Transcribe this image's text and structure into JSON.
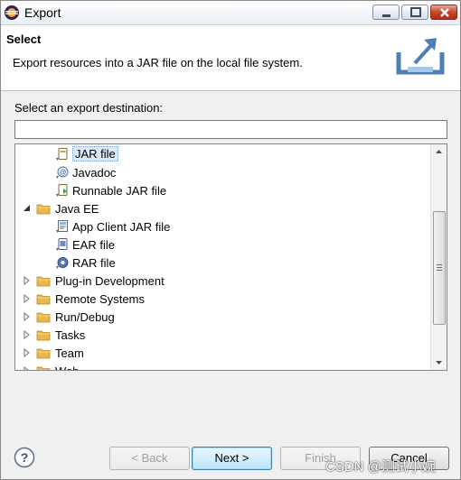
{
  "window": {
    "title": "Export",
    "controls": {
      "minimize": "minimize",
      "maximize": "maximize",
      "close": "close"
    }
  },
  "banner": {
    "title": "Select",
    "description": "Export resources into a JAR file on the local file system."
  },
  "destination": {
    "label": "Select an export destination:",
    "filter_value": "",
    "filter_placeholder": ""
  },
  "tree": {
    "items": [
      {
        "label": "JAR file",
        "icon": "jar-file-icon",
        "level": 2,
        "selected": true
      },
      {
        "label": "Javadoc",
        "icon": "javadoc-icon",
        "level": 2
      },
      {
        "label": "Runnable JAR file",
        "icon": "runnable-jar-icon",
        "level": 2
      },
      {
        "label": "Java EE",
        "icon": "folder-icon",
        "level": 1,
        "expanded": true
      },
      {
        "label": "App Client JAR file",
        "icon": "app-client-jar-icon",
        "level": 2
      },
      {
        "label": "EAR file",
        "icon": "ear-file-icon",
        "level": 2
      },
      {
        "label": "RAR file",
        "icon": "rar-file-icon",
        "level": 2
      },
      {
        "label": "Plug-in Development",
        "icon": "folder-icon",
        "level": 1,
        "expanded": false
      },
      {
        "label": "Remote Systems",
        "icon": "folder-icon",
        "level": 1,
        "expanded": false
      },
      {
        "label": "Run/Debug",
        "icon": "folder-icon",
        "level": 1,
        "expanded": false
      },
      {
        "label": "Tasks",
        "icon": "folder-icon",
        "level": 1,
        "expanded": false
      },
      {
        "label": "Team",
        "icon": "folder-icon",
        "level": 1,
        "expanded": false
      },
      {
        "label": "Web",
        "icon": "folder-icon",
        "level": 1,
        "expanded": false
      }
    ]
  },
  "buttons": {
    "help": "?",
    "back": "< Back",
    "next": "Next >",
    "finish": "Finish",
    "cancel": "Cancel"
  },
  "watermark": "CSDN @测试小婉",
  "colors": {
    "selection_bg": "#dbe8f7",
    "default_button": "#bee6fd",
    "folder": "#e8b84a"
  }
}
